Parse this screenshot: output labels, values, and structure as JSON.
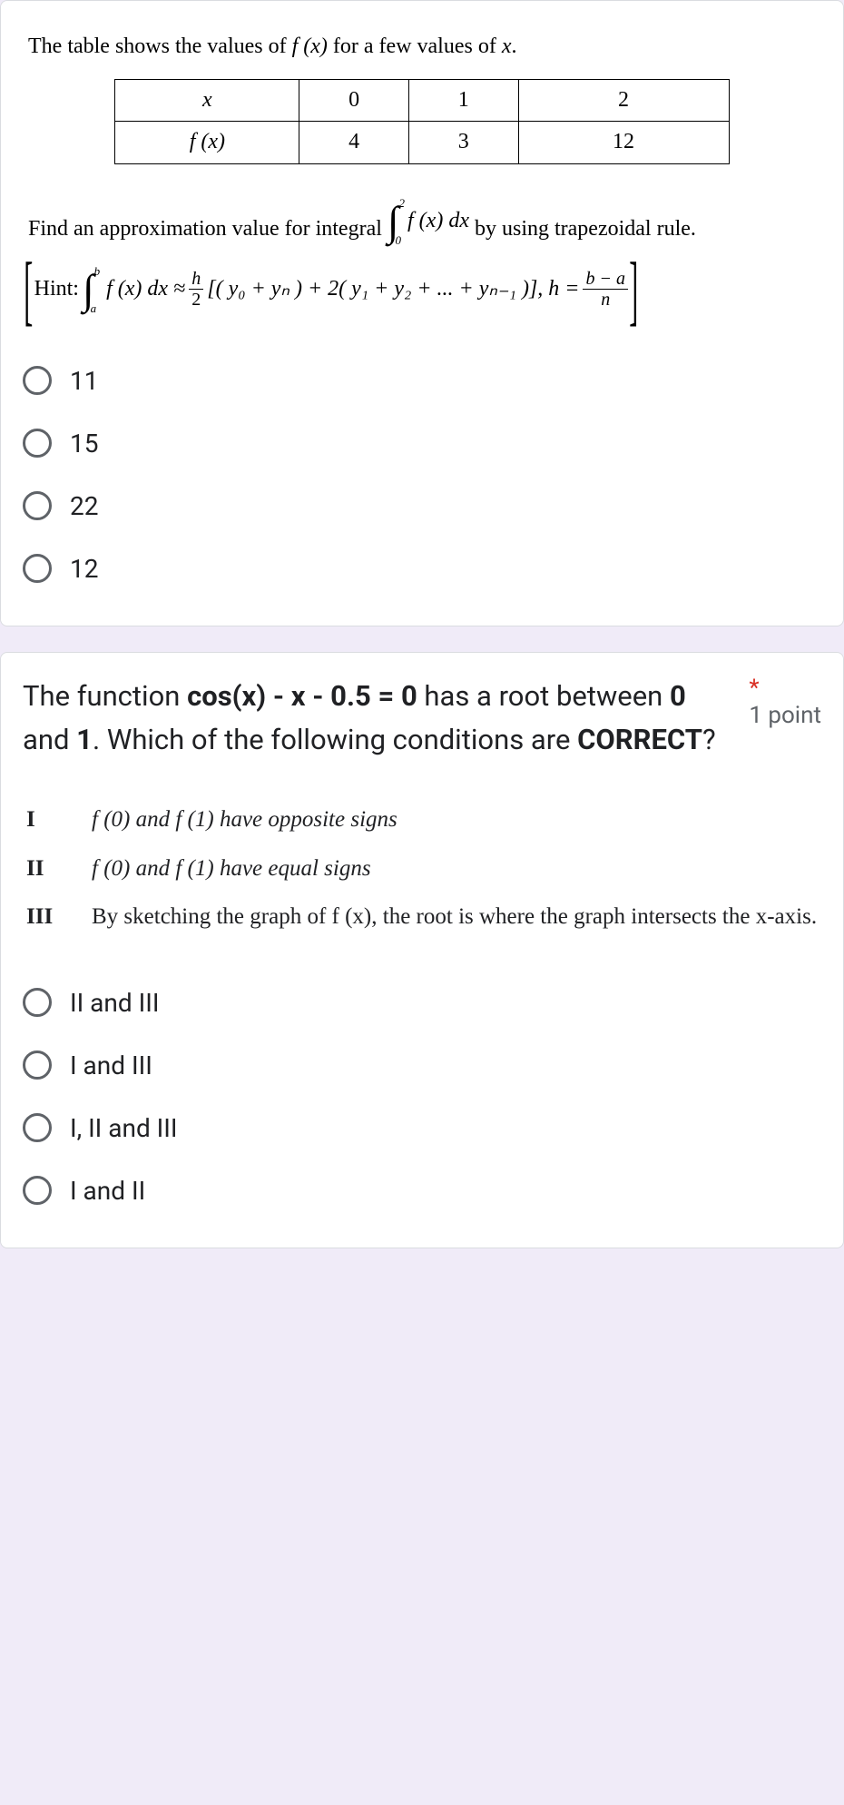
{
  "q1": {
    "intro_a": "The table shows the values of  ",
    "intro_b": "  for a few values of  ",
    "fx": "f (x)",
    "x": "x",
    "dot": ".",
    "table": {
      "h1": "x",
      "h2": "0",
      "h3": "1",
      "h4": "2",
      "r1": "f (x)",
      "r2": "4",
      "r3": "3",
      "r4": "12"
    },
    "find_a": "Find an approximation value for integral  ",
    "find_b": "  by using trapezoidal rule.",
    "int_sup": "2",
    "int_sub": "0",
    "int_fn": "f (x) dx",
    "hint_label": "Hint:",
    "hint_int_sup": "b",
    "hint_int_sub": "a",
    "hint_fn": "f (x) dx ≈ ",
    "frac_h_num": "h",
    "frac_h_den": "2",
    "hint_body": "[( y₀ + yₙ ) + 2( y₁ + y₂ + ... + yₙ₋₁ )],   h = ",
    "frac_ba_num": "b − a",
    "frac_ba_den": "n",
    "options": [
      "11",
      "15",
      "22",
      "12"
    ]
  },
  "q2": {
    "stem_a": "The function  ",
    "stem_eq": "cos(x) - x - 0.5 = 0",
    "stem_b": " has a root between ",
    "zero": "0",
    "and": " and ",
    "one": "1",
    "stem_c": ". Which of the following conditions are ",
    "correct": "CORRECT",
    "qmark": "?",
    "points": "1 point",
    "conds": [
      {
        "num": "I",
        "a": "f (0) and  f (1)  have opposite signs"
      },
      {
        "num": "II",
        "a": "f (0) and  f (1)  have equal signs"
      },
      {
        "num": "III",
        "a": "By sketching the graph of  f (x),  the root is where the graph intersects the x-axis."
      }
    ],
    "options": [
      "II and III",
      "I and III",
      "I, II and III",
      "I and II"
    ]
  }
}
